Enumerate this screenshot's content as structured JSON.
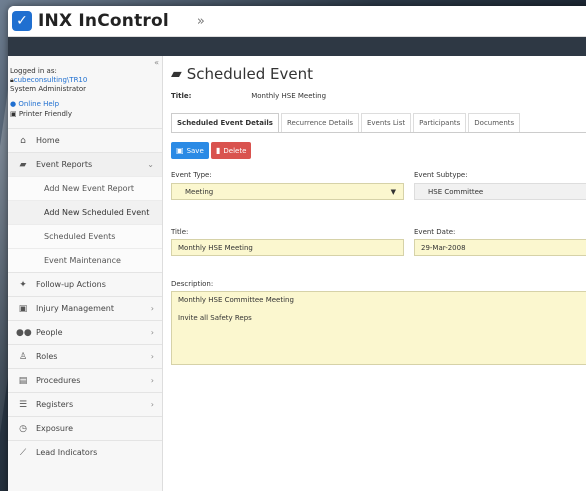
{
  "app": {
    "title": "INX InControl"
  },
  "sidebar": {
    "logged_in_as_label": "Logged in as:",
    "username": "cubeconsulting\\TR10",
    "role": "System Administrator",
    "online_help": "Online Help",
    "printer_friendly": "Printer Friendly",
    "items": [
      {
        "label": "Home",
        "icon": "home-icon"
      },
      {
        "label": "Event Reports",
        "icon": "folder-open-icon"
      },
      {
        "label": "Follow-up Actions",
        "icon": "running-icon"
      },
      {
        "label": "Injury Management",
        "icon": "medkit-icon"
      },
      {
        "label": "People",
        "icon": "users-icon"
      },
      {
        "label": "Roles",
        "icon": "user-tie-icon"
      },
      {
        "label": "Procedures",
        "icon": "book-icon"
      },
      {
        "label": "Registers",
        "icon": "list-icon"
      },
      {
        "label": "Exposure",
        "icon": "clock-icon"
      },
      {
        "label": "Lead Indicators",
        "icon": "line-chart-icon"
      }
    ],
    "sub_items": [
      {
        "label": "Add New Event Report"
      },
      {
        "label": "Add New Scheduled Event"
      },
      {
        "label": "Scheduled Events"
      },
      {
        "label": "Event Maintenance"
      }
    ]
  },
  "main": {
    "page_title": "Scheduled Event",
    "title_label": "Title:",
    "title_value": "Monthly HSE Meeting",
    "tabs": [
      {
        "label": "Scheduled Event Details"
      },
      {
        "label": "Recurrence Details"
      },
      {
        "label": "Events List"
      },
      {
        "label": "Participants"
      },
      {
        "label": "Documents"
      }
    ],
    "save_label": "Save",
    "delete_label": "Delete",
    "event_type_label": "Event Type:",
    "event_type_value": "Meeting",
    "event_subtype_label": "Event Subtype:",
    "event_subtype_value": "HSE Committee",
    "title_field_label": "Title:",
    "title_field_value": "Monthly HSE Meeting",
    "event_date_label": "Event Date:",
    "event_date_value": "29-Mar-2008",
    "description_label": "Description:",
    "description_line1": "Monthly HSE Committee Meeting",
    "description_line2": "Invite all Safety Reps"
  }
}
